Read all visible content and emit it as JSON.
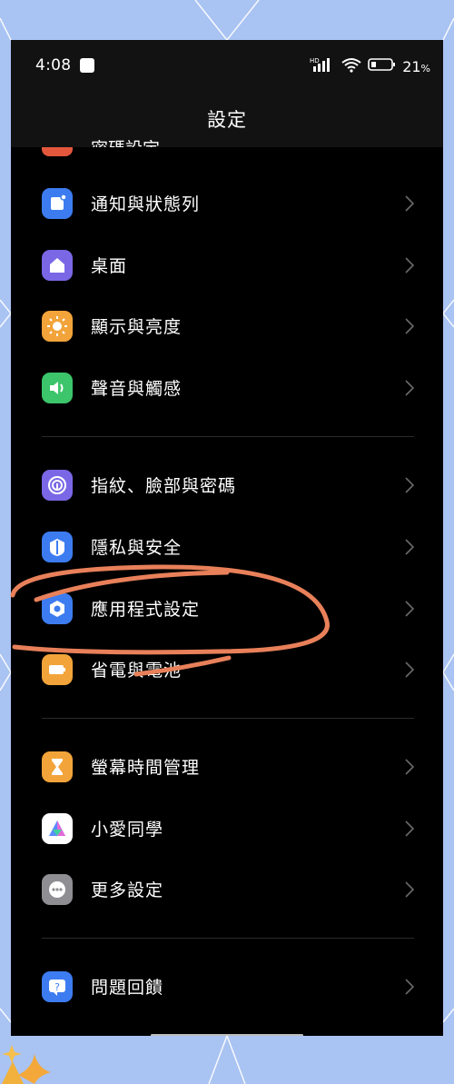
{
  "status": {
    "time": "4:08",
    "network": "HD",
    "battery": "21",
    "battery_unit": "%"
  },
  "header": {
    "title": "設定"
  },
  "partial_top_item": {
    "label": "密碼設定",
    "icon": "lock-icon",
    "color": "#e4573d"
  },
  "sections": [
    [
      {
        "label": "通知與狀態列",
        "icon": "notification-icon",
        "color": "#3d7cf0"
      },
      {
        "label": "桌面",
        "icon": "home-icon",
        "color": "#7a67e6"
      },
      {
        "label": "顯示與亮度",
        "icon": "brightness-icon",
        "color": "#f2a43a"
      },
      {
        "label": "聲音與觸感",
        "icon": "speaker-icon",
        "color": "#3cc56a"
      }
    ],
    [
      {
        "label": "指紋、臉部與密碼",
        "icon": "fingerprint-icon",
        "color": "#7a67e6"
      },
      {
        "label": "隱私與安全",
        "icon": "privacy-shield-icon",
        "color": "#3d7cf0"
      },
      {
        "label": "應用程式設定",
        "icon": "app-hexagon-icon",
        "color": "#3d7cf0"
      },
      {
        "label": "省電與電池",
        "icon": "battery-icon",
        "color": "#f2a43a"
      }
    ],
    [
      {
        "label": "螢幕時間管理",
        "icon": "hourglass-icon",
        "color": "#f2a43a"
      },
      {
        "label": "小愛同學",
        "icon": "assistant-icon",
        "color": "#ffffff"
      },
      {
        "label": "更多設定",
        "icon": "more-dots-icon",
        "color": "#8e8e93"
      }
    ],
    [
      {
        "label": "問題回饋",
        "icon": "feedback-icon",
        "color": "#3d7cf0"
      }
    ]
  ],
  "accent": {
    "annotation": "#e8805a",
    "background": "#a9c3f2"
  }
}
